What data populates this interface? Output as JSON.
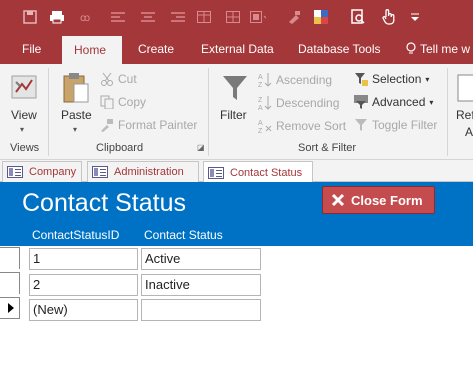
{
  "ribbon_tabs": [
    {
      "label": "File"
    },
    {
      "label": "Home"
    },
    {
      "label": "Create"
    },
    {
      "label": "External Data"
    },
    {
      "label": "Database Tools"
    },
    {
      "label": "Tell me w"
    }
  ],
  "groups": {
    "views": {
      "label": "Views",
      "view_button": "View"
    },
    "clipboard": {
      "label": "Clipboard",
      "paste": "Paste",
      "cut": "Cut",
      "copy": "Copy",
      "format_painter": "Format Painter"
    },
    "sort_filter": {
      "label": "Sort & Filter",
      "filter": "Filter",
      "ascending": "Ascending",
      "descending": "Descending",
      "remove_sort": "Remove Sort",
      "selection": "Selection",
      "advanced": "Advanced",
      "toggle_filter": "Toggle Filter"
    },
    "records": {
      "refresh_line1": "Refr",
      "refresh_line2": "A"
    }
  },
  "object_tabs": [
    {
      "label": "Company"
    },
    {
      "label": "Administration"
    },
    {
      "label": "Contact Status"
    }
  ],
  "form": {
    "title": "Contact Status",
    "close_button": "Close Form",
    "columns": [
      "ContactStatusID",
      "Contact Status"
    ],
    "rows": [
      {
        "id": "1",
        "status": "Active"
      },
      {
        "id": "2",
        "status": "Inactive"
      },
      {
        "id": "(New)",
        "status": ""
      }
    ]
  },
  "colors": {
    "accent": "#a4373a",
    "form_header": "#0072c6",
    "close_button": "#c44b4e"
  }
}
